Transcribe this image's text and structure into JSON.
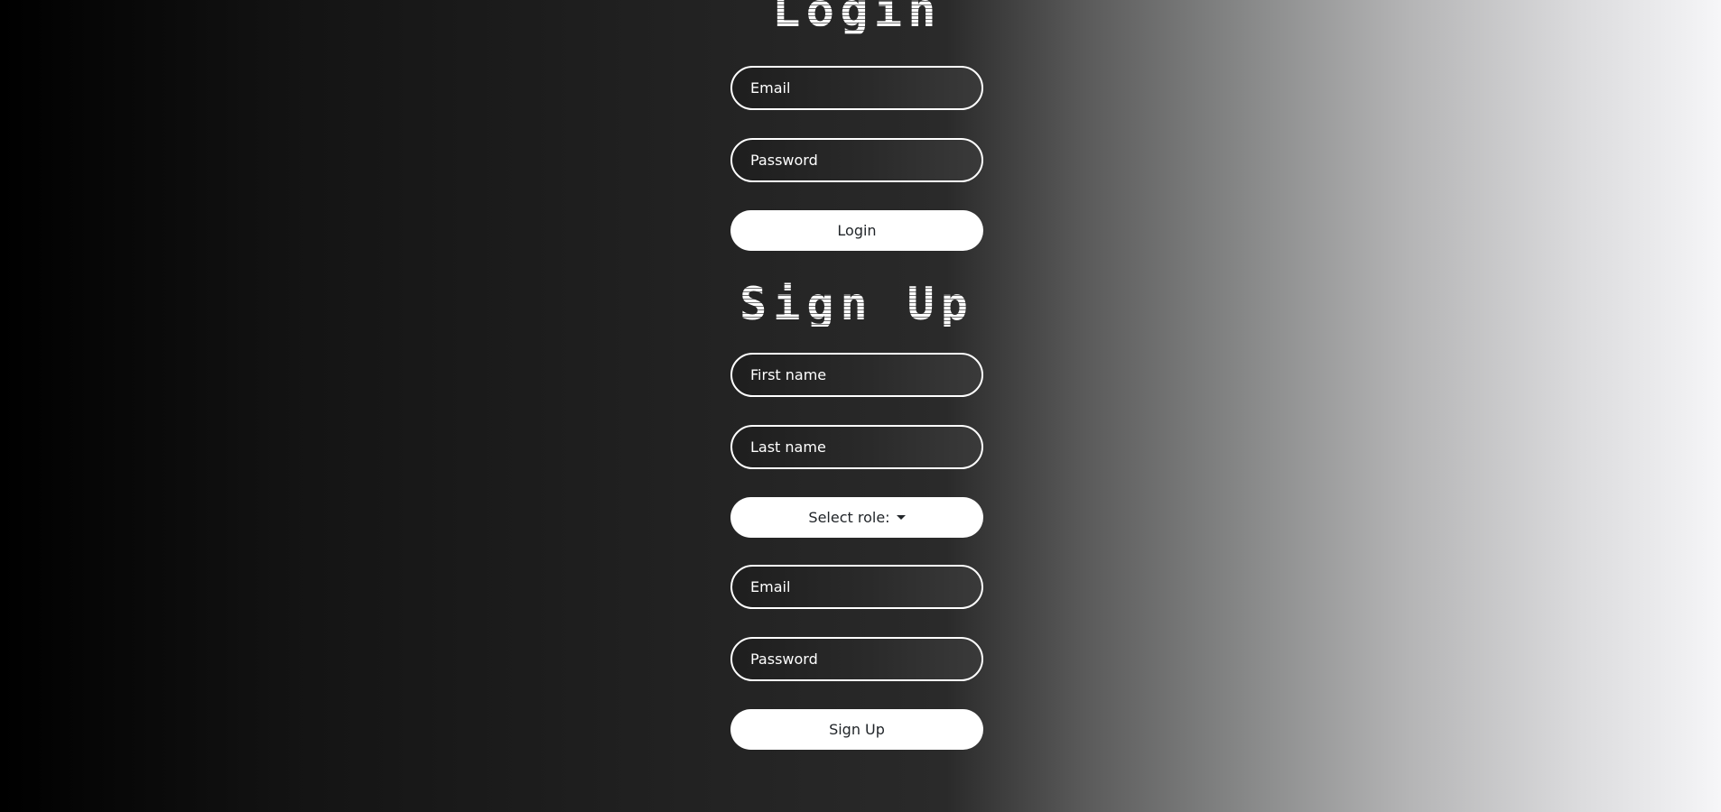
{
  "login": {
    "title": "Login",
    "email_placeholder": "Email",
    "password_placeholder": "Password",
    "submit_label": "Login"
  },
  "signup": {
    "title": "Sign Up",
    "first_name_placeholder": "First name",
    "last_name_placeholder": "Last name",
    "role_label": "Select role:",
    "email_placeholder": "Email",
    "password_placeholder": "Password",
    "submit_label": "Sign Up"
  }
}
